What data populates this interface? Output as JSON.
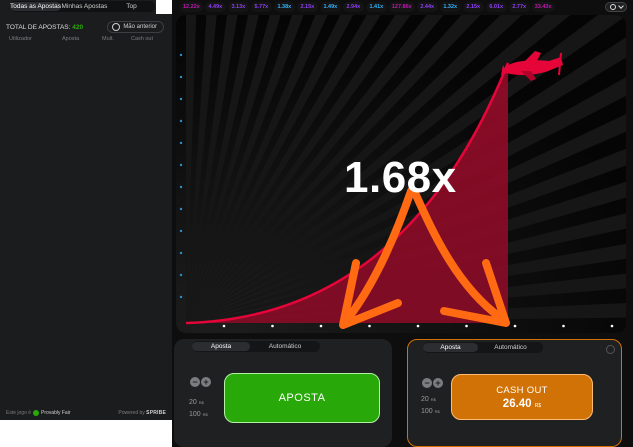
{
  "left_panel": {
    "tabs": [
      {
        "label": "Todas as Apostas",
        "active": true
      },
      {
        "label": "Minhas Apostas",
        "active": false
      },
      {
        "label": "Top",
        "active": false
      }
    ],
    "total_label": "TOTAL DE APOSTAS:",
    "total_count": "420",
    "previous_button": "Mão anterior",
    "columns": [
      "Utilizador",
      "Aposta",
      "Mult.",
      "Cash out"
    ],
    "footer": {
      "left_text": "Este jogo é",
      "provably_fair": "Provably Fair",
      "right_text": "Powered by",
      "brand": "SPRIBE"
    }
  },
  "history": [
    {
      "value": "12.22x",
      "color": "#c017b4"
    },
    {
      "value": "4.49x",
      "color": "#913ef8"
    },
    {
      "value": "3.13x",
      "color": "#913ef8"
    },
    {
      "value": "5.77x",
      "color": "#913ef8"
    },
    {
      "value": "1.38x",
      "color": "#34b4ff"
    },
    {
      "value": "2.15x",
      "color": "#913ef8"
    },
    {
      "value": "1.49x",
      "color": "#34b4ff"
    },
    {
      "value": "2.94x",
      "color": "#913ef8"
    },
    {
      "value": "1.41x",
      "color": "#34b4ff"
    },
    {
      "value": "127.86x",
      "color": "#c017b4"
    },
    {
      "value": "2.44x",
      "color": "#913ef8"
    },
    {
      "value": "1.32x",
      "color": "#34b4ff"
    },
    {
      "value": "2.15x",
      "color": "#913ef8"
    },
    {
      "value": "6.01x",
      "color": "#913ef8"
    },
    {
      "value": "2.77x",
      "color": "#913ef8"
    },
    {
      "value": "33.43x",
      "color": "#c017b4"
    }
  ],
  "game": {
    "multiplier": "1.68x",
    "curve_color": "#e50539",
    "arrow_color": "#ff6a13"
  },
  "bet_panel_1": {
    "tabs": [
      {
        "label": "Aposta",
        "active": true
      },
      {
        "label": "Automático",
        "active": false
      }
    ],
    "presets": [
      "20",
      "100"
    ],
    "presets_suffix": "R$",
    "button_label": "APOSTA"
  },
  "bet_panel_2": {
    "tabs": [
      {
        "label": "Aposta",
        "active": true
      },
      {
        "label": "Automático",
        "active": false
      }
    ],
    "presets": [
      "20",
      "100"
    ],
    "presets_suffix": "R$",
    "button_label": "CASH OUT",
    "button_amount": "26.40",
    "button_currency": "R$"
  },
  "colors": {
    "accent_green": "#28a909",
    "accent_orange": "#d07206",
    "curve_red": "#e50539"
  }
}
